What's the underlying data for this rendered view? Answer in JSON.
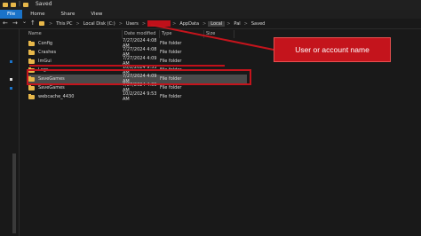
{
  "titlebar": {
    "separator": "|",
    "title": "Saved"
  },
  "ribbon": {
    "tabs": [
      "File",
      "Home",
      "Share",
      "View"
    ]
  },
  "nav": {
    "back": "←",
    "forward": "→",
    "recent": "⌄",
    "up": "↑"
  },
  "breadcrumb": {
    "items": [
      "This PC",
      "Local Disk (C:)",
      "Users",
      "AppData",
      "Local",
      "Pal",
      "Saved"
    ],
    "separator": ">"
  },
  "columns": {
    "name": "Name",
    "date": "Date modified",
    "type": "Type",
    "size": "Size"
  },
  "files": [
    {
      "name": "Config",
      "date": "7/27/2024 4:08 AM",
      "type": "File folder"
    },
    {
      "name": "Crashes",
      "date": "7/27/2024 4:08 AM",
      "type": "File folder"
    },
    {
      "name": "ImGui",
      "date": "7/27/2024 4:09 AM",
      "type": "File folder"
    },
    {
      "name": "Logs",
      "date": "10/2/2024 9:53 AM",
      "type": "File folder"
    },
    {
      "name": "SaveGames",
      "date": "7/27/2024 4:09 AM",
      "type": "File folder"
    },
    {
      "name": "SaveGames",
      "date": "7/27/2024 4:09 AM",
      "type": "File folder"
    },
    {
      "name": "webcache_4430",
      "date": "10/2/2024 9:53 AM",
      "type": "File folder"
    }
  ],
  "callout": {
    "label": "User or account name"
  },
  "colors": {
    "accent": "#1a73c9",
    "highlight": "#c4141c",
    "folder": "#e8b84a"
  }
}
